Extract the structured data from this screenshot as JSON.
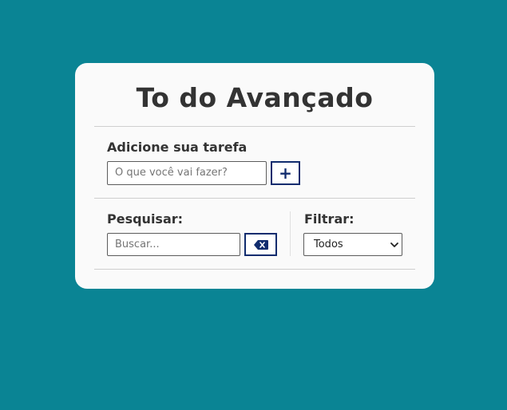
{
  "app": {
    "title": "To do Avançado"
  },
  "add_task": {
    "label": "Adicione sua tarefa",
    "placeholder": "O que você vai fazer?",
    "value": "",
    "button_icon": "plus-icon",
    "button_text": "+"
  },
  "search": {
    "label": "Pesquisar:",
    "placeholder": "Buscar...",
    "value": "",
    "clear_button_icon": "backspace-icon"
  },
  "filter": {
    "label": "Filtrar:",
    "selected": "Todos",
    "icon": "chevron-down-icon"
  },
  "colors": {
    "background": "#0a8494",
    "card": "#fafafa",
    "accent": "#102c6e",
    "text": "#333333"
  }
}
